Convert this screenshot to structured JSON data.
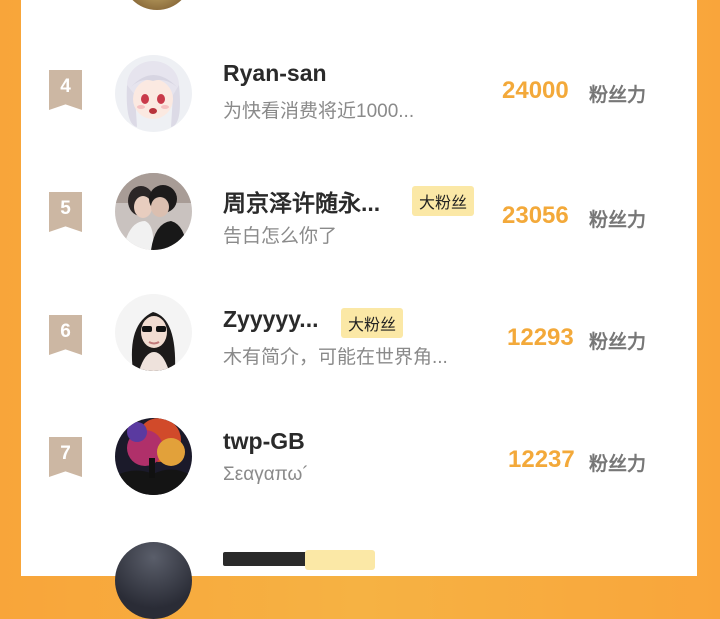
{
  "fan_list": {
    "unit_label": "粉丝力",
    "items": [
      {
        "rank": "4",
        "name": "Ryan-san",
        "badge": "",
        "desc": "为快看消费将近1000...",
        "score": "24000"
      },
      {
        "rank": "5",
        "name": "周京泽许随永...",
        "badge": "大粉丝",
        "desc": "告白怎么你了",
        "score": "23056"
      },
      {
        "rank": "6",
        "name": "Zyyyyy...",
        "badge": "大粉丝",
        "desc": "木有简介，可能在世界角...",
        "score": "12293"
      },
      {
        "rank": "7",
        "name": "twp-GB",
        "badge": "",
        "desc": "Σεαγαπω´",
        "score": "12237"
      }
    ]
  }
}
